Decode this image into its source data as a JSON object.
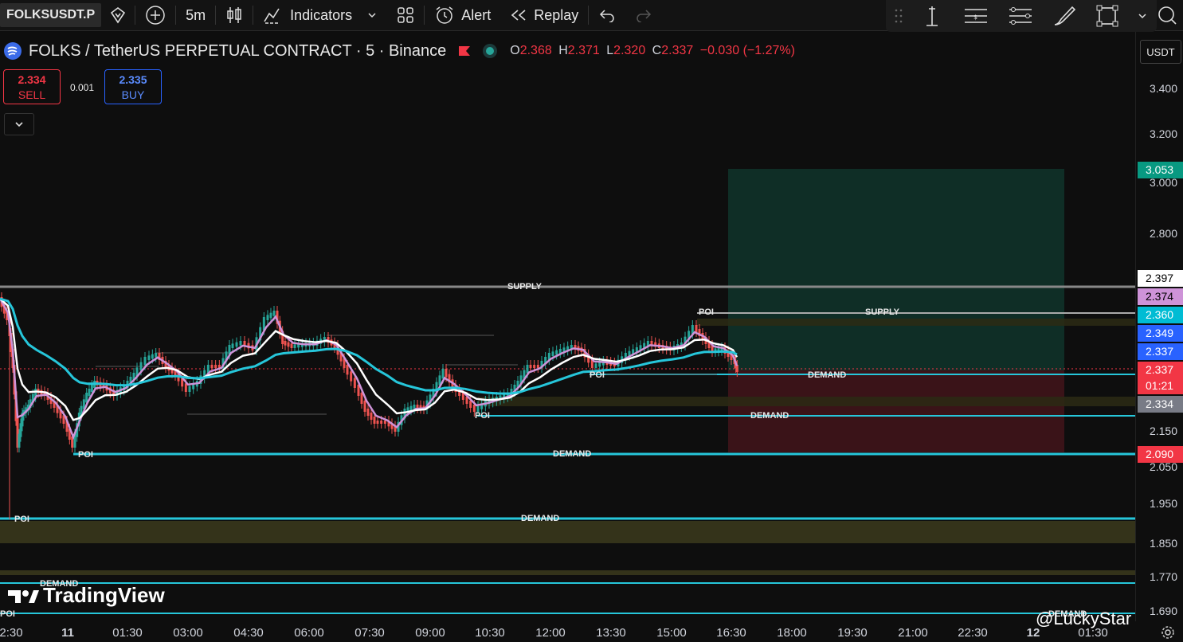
{
  "toolbar": {
    "symbol": "FOLKSUSDT.P",
    "interval": "5m",
    "indicators_label": "Indicators",
    "alert_label": "Alert",
    "replay_label": "Replay"
  },
  "legend": {
    "title": "FOLKS / TetherUS PERPETUAL CONTRACT · 5 · Binance",
    "open_key": "O",
    "open": "2.368",
    "high_key": "H",
    "high": "2.371",
    "low_key": "L",
    "low": "2.320",
    "close_key": "C",
    "close": "2.337",
    "change": "−0.030 (−1.27%)"
  },
  "trade": {
    "sell_price": "2.334",
    "sell_label": "SELL",
    "quantity": "0.001",
    "buy_price": "2.335",
    "buy_label": "BUY"
  },
  "price_axis": {
    "currency": "USDT",
    "labels": [
      "3.400",
      "3.200",
      "3.000",
      "2.800",
      "2.150",
      "2.050",
      "1.950",
      "1.850",
      "1.770",
      "1.690"
    ],
    "tags": [
      {
        "text": "3.053",
        "color": "#089981"
      },
      {
        "text": "2.397",
        "color": "#ffffff",
        "fg": "#000000"
      },
      {
        "text": "2.374",
        "color": "#ce93d8",
        "fg": "#000000"
      },
      {
        "text": "2.360",
        "color": "#00bcd4"
      },
      {
        "text": "2.349",
        "color": "#2962ff"
      },
      {
        "text": "2.337",
        "color": "#2962ff"
      },
      {
        "text": "2.337",
        "color": "#f23645"
      },
      {
        "text": "01:21",
        "color": "#f23645"
      },
      {
        "text": "2.334",
        "color": "#787b86"
      },
      {
        "text": "2.090",
        "color": "#f23645"
      }
    ]
  },
  "time_axis": {
    "labels": [
      "2:30",
      "11",
      "01:30",
      "03:00",
      "04:30",
      "06:00",
      "07:30",
      "09:00",
      "10:30",
      "12:00",
      "13:30",
      "15:00",
      "16:30",
      "18:00",
      "19:30",
      "21:00",
      "22:30",
      "12",
      "01:30"
    ]
  },
  "levels": {
    "supply": "SUPPLY",
    "demand": "DEMAND",
    "poi": "POI"
  },
  "branding": {
    "logo": "TradingView",
    "watermark": "@LuckyStar"
  },
  "colors": {
    "bull": "#26a69a",
    "bear": "#ef5350",
    "ema_fast": "#ce93d8",
    "ema_mid": "#ffffff",
    "ema_slow": "#26c6da",
    "demand_line": "#26c6da",
    "zone": "#3b3a1c"
  }
}
